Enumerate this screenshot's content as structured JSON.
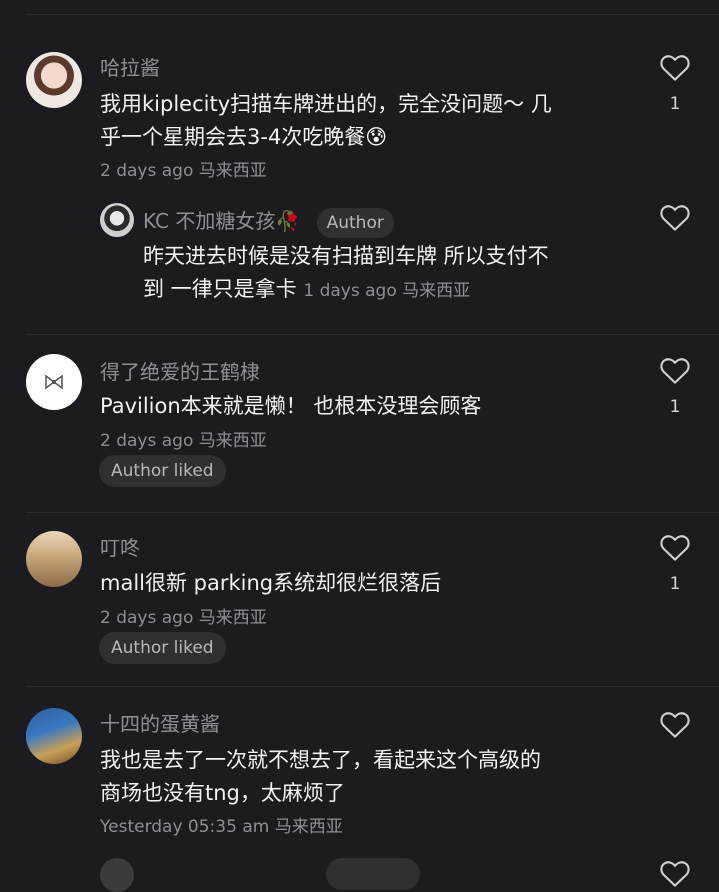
{
  "comments": [
    {
      "name": "哈拉酱",
      "text": "我用kiplecity扫描车牌进出的，完全没问题～ 几乎一个星期会去3-4次吃晚餐😰",
      "line1": "我用kiplecity扫描车牌进出的，完全没问题～ 几",
      "line2": "乎一个星期会去3-4次吃晚餐😰",
      "meta": "2 days ago 马来西亚",
      "likes": "1"
    },
    {
      "name": "KC 不加糖女孩🥀",
      "tag": "Author",
      "line1": "昨天进去时候是没有扫描到车牌 所以支付不",
      "line2": "到 一律只是拿卡",
      "meta": "1 days ago 马来西亚"
    },
    {
      "name": "得了绝爱的王鹤棣",
      "text": "Pavilion本来就是懒！ 也根本没理会顾客",
      "meta": "2 days ago 马来西亚",
      "pill": "Author liked",
      "likes": "1"
    },
    {
      "name": "叮咚",
      "text": "mall很新 parking系统却很烂很落后",
      "meta": "2 days ago 马来西亚",
      "pill": "Author liked",
      "likes": "1"
    },
    {
      "name": "十四的蛋黄酱",
      "line1": "我也是去了一次就不想去了，看起来这个高级的",
      "line2": "商场也没有tng，太麻烦了",
      "meta": "Yesterday 05:35 am 马来西亚"
    }
  ],
  "icons": {
    "like": "heart-outline-icon"
  },
  "colors": {
    "background": "#1c1c20",
    "secondary_text": "#8e8e94",
    "pill_bg": "#2f2f34"
  }
}
